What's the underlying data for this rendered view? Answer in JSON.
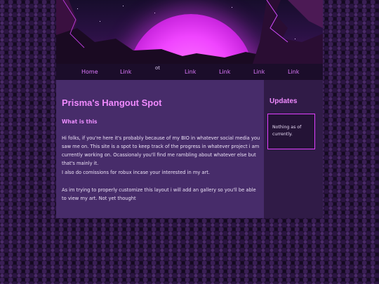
{
  "nav": {
    "items": [
      "Home",
      "Link",
      "Link",
      "Link",
      "Link",
      "Link"
    ],
    "stray_text": "ot"
  },
  "main": {
    "title": "Prisma's Hangout Spot",
    "subheading": "What is this",
    "paragraphs": [
      "Hi folks, if you're here it's probably because of my BIO in whatever social media you saw me on. This site is a spot to keep track of the progress in whatever project i am currently working on. Ocassionaly you'll find me rambling about whatever else but that's mainly it.",
      "I also do comissions for robux incase your interested in my art.",
      "As im trying to properly customize this layout i will add an gallery so you'll be able to view my art. Not yet thought"
    ]
  },
  "sidebar": {
    "title": "Updates",
    "box_text": "Nothing as of currently."
  },
  "colors": {
    "accent": "#f08aff",
    "border": "#e040ff",
    "main_bg": "#472c6a",
    "sidebar_bg": "#301b47",
    "nav_bg": "#1b0d2a"
  }
}
